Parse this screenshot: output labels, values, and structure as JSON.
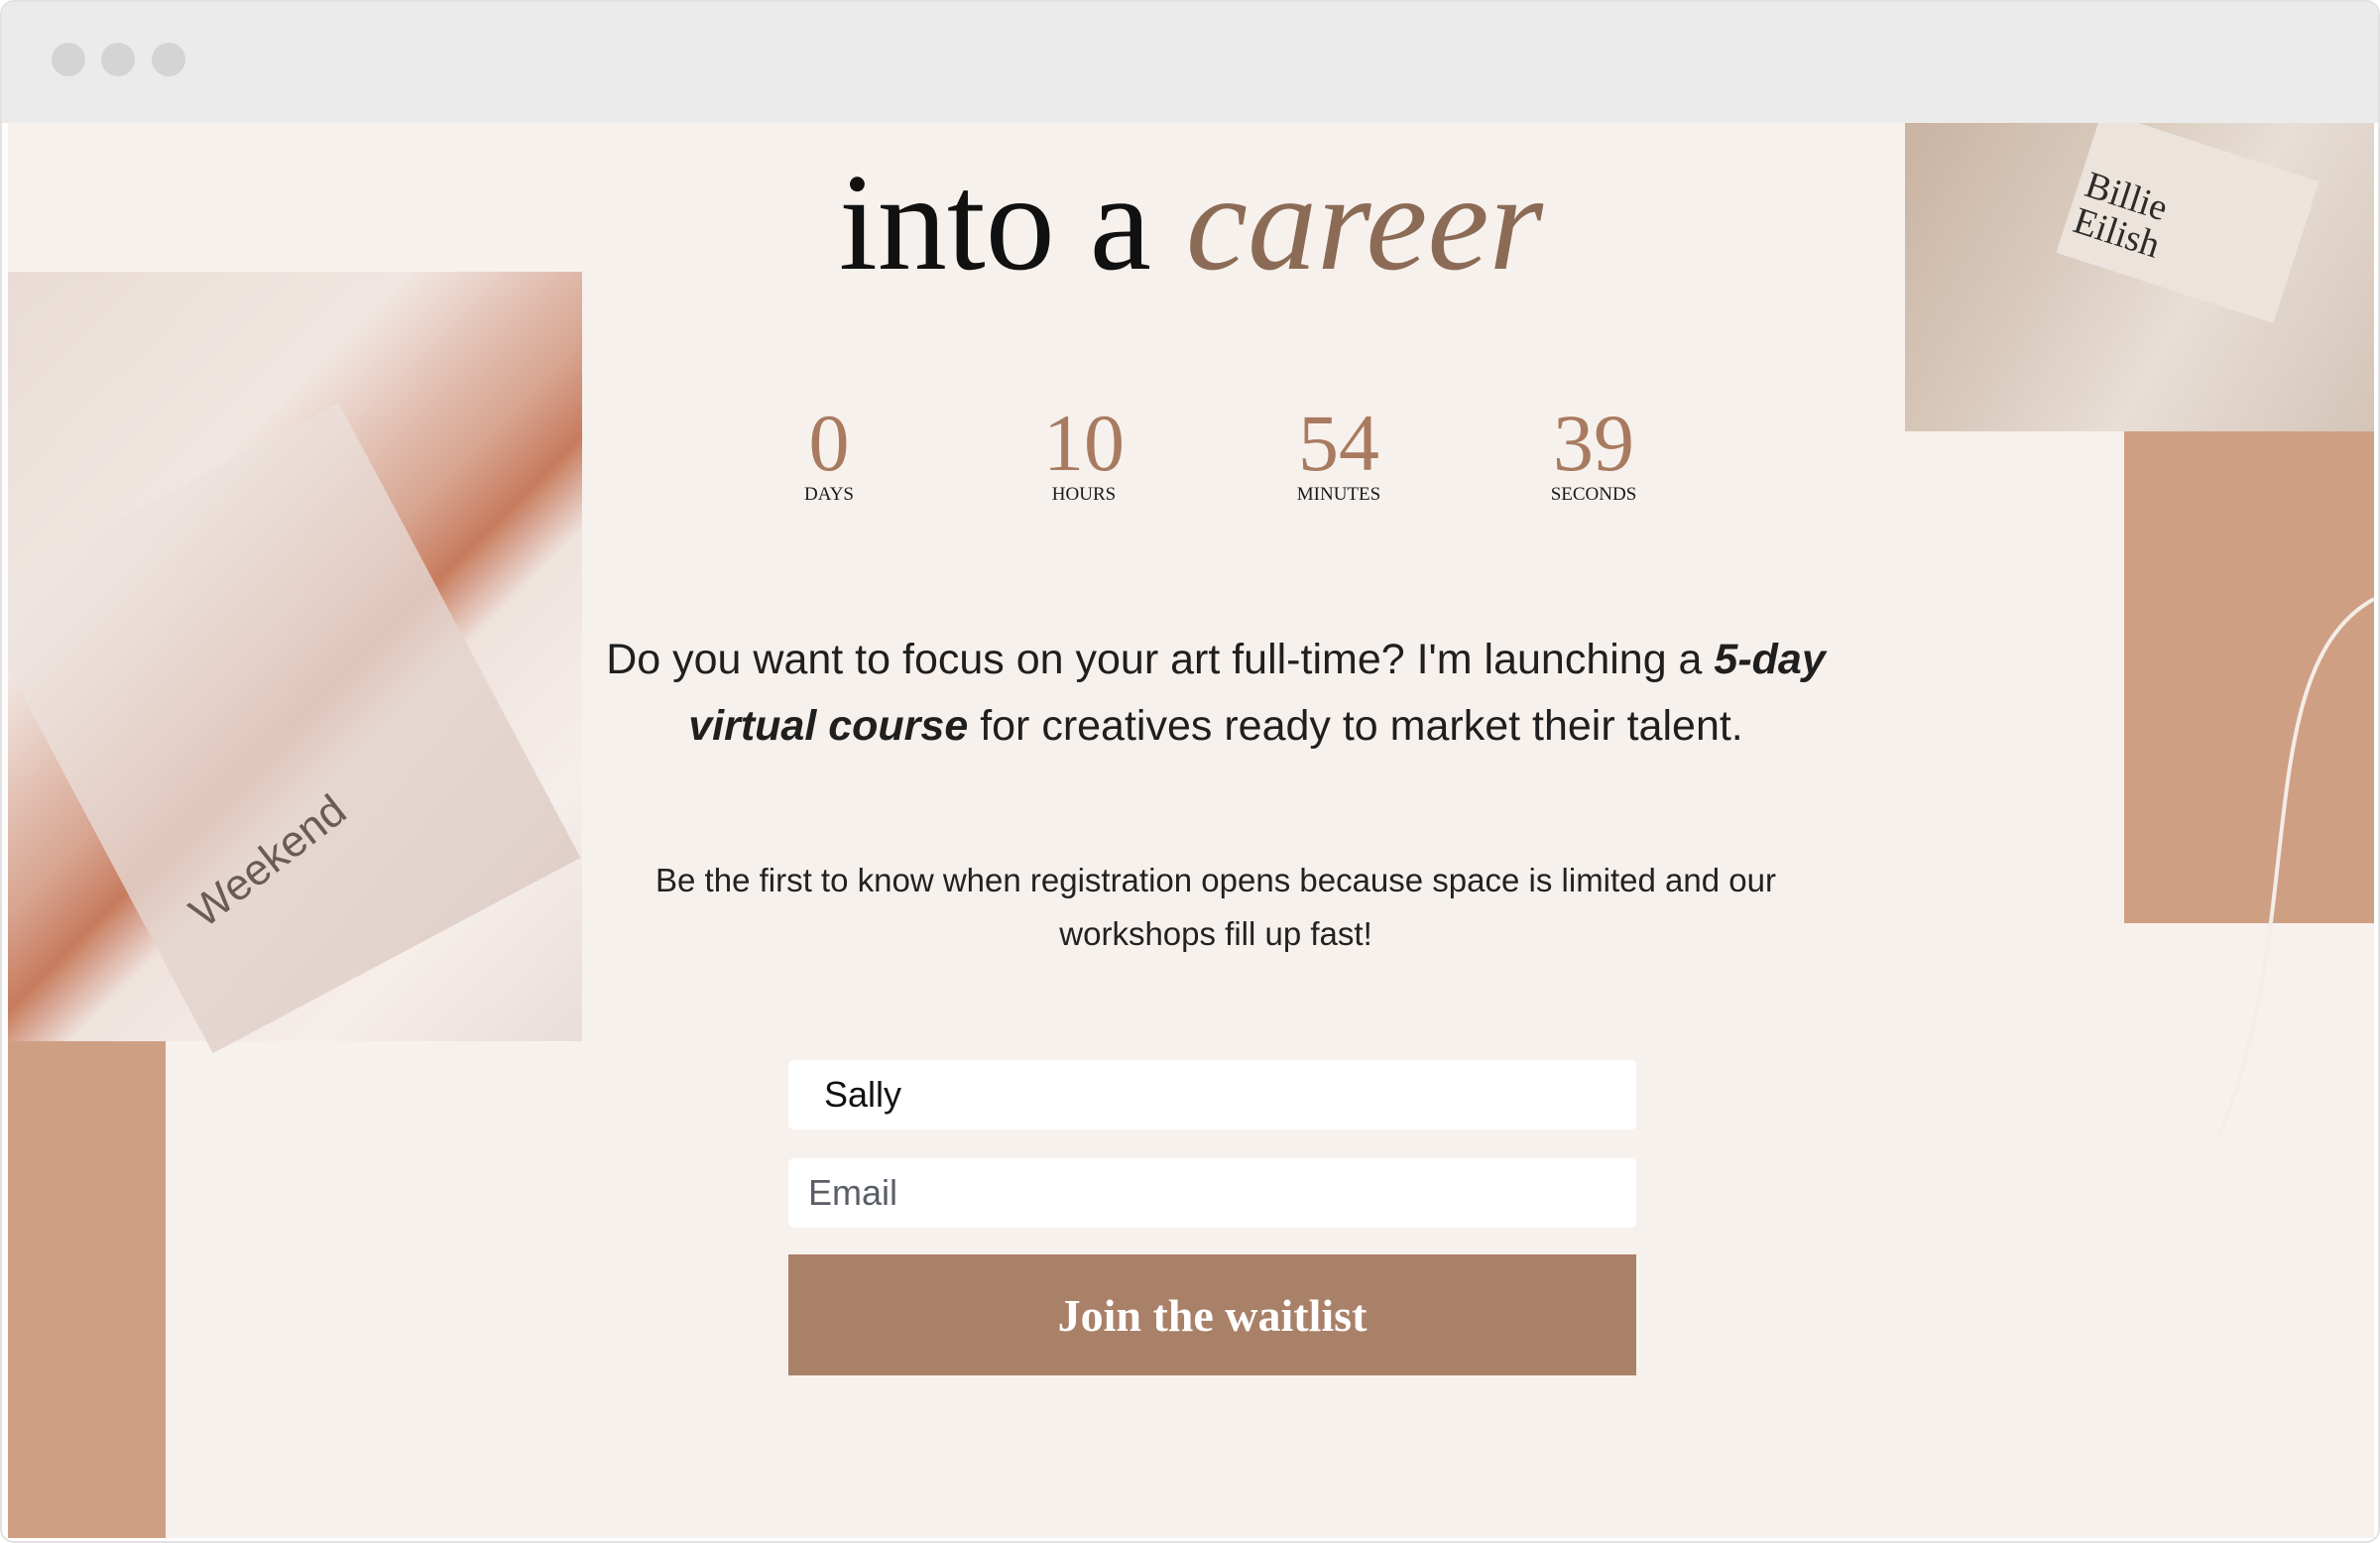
{
  "window": {
    "controls": [
      "close",
      "minimize",
      "maximize"
    ]
  },
  "hero": {
    "heading_plain": "into a ",
    "heading_accent": "career"
  },
  "images": {
    "left_caption": "Weekend",
    "right_caption_line1": "Billie",
    "right_caption_line2": "Eilish"
  },
  "countdown": [
    {
      "value": "0",
      "label": "DAYS"
    },
    {
      "value": "10",
      "label": "HOURS"
    },
    {
      "value": "54",
      "label": "MINUTES"
    },
    {
      "value": "39",
      "label": "SECONDS"
    }
  ],
  "intro": {
    "before": "Do you want to focus on your art full-time? I'm launching a ",
    "emphasis": "5-day virtual course",
    "after": " for creatives ready to market their talent."
  },
  "subtext": "Be the first to know when registration opens because space is limited and our workshops fill up fast!",
  "form": {
    "name_value": "Sally",
    "email_placeholder": "Email",
    "submit_label": "Join the waitlist"
  },
  "colors": {
    "background": "#f7f1ed",
    "accent": "#a98068",
    "tan_block": "#cf9f84",
    "heading_accent": "#8c6b56"
  }
}
